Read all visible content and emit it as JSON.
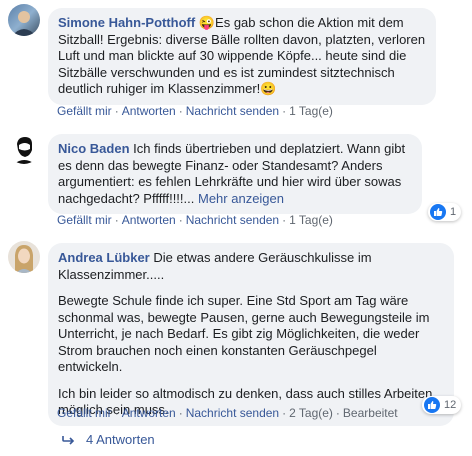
{
  "comments": [
    {
      "author": "Simone Hahn-Potthoff",
      "emoji_after_author": "😜",
      "text": "Es gab schon die Aktion mit dem Sitzball! Ergebnis: diverse Bälle rollten davon, platzten, verloren Luft und man blickte auf 30 wippende Köpfe... heute sind die Sitzbälle verschwunden und es ist zumindest sitztechnisch deutlich ruhiger im Klassenzimmer!",
      "emoji_end": "😀",
      "actions": {
        "like": "Gefällt mir",
        "reply": "Antworten",
        "message": "Nachricht senden",
        "time": "1 Tag(e)"
      }
    },
    {
      "author": "Nico Baden",
      "text": "Ich finds übertrieben und deplatziert. Wann gibt es denn das bewegte Finanz- oder Standesamt? Anders argumentiert: es fehlen Lehrkräfte und hier wird über sowas nachgedacht? Pfffff!!!!...",
      "more": "Mehr anzeigen",
      "actions": {
        "like": "Gefällt mir",
        "reply": "Antworten",
        "message": "Nachricht senden",
        "time": "1 Tag(e)"
      },
      "reaction_count": "1"
    },
    {
      "author": "Andrea Lübker",
      "text_p1": "Die etwas andere Geräuschkulisse im Klassenzimmer.....",
      "text_p2": "Bewegte Schule finde ich super. Eine Std Sport am Tag wäre schonmal was, bewegte Pausen, gerne auch Bewegungsteile im Unterricht, je nach Bedarf. Es gibt zig Möglichkeiten, die weder Strom brauchen noch einen konstanten Geräuschpegel entwickeln.",
      "text_p3": "Ich bin leider so altmodisch zu denken, dass auch stilles Arbeiten möglich sein muss.",
      "actions": {
        "like": "Gefällt mir",
        "reply": "Antworten",
        "message": "Nachricht senden",
        "time": "2 Tag(e)",
        "edited": "Bearbeitet"
      },
      "reaction_count": "12"
    }
  ],
  "replies_link": "4 Antworten",
  "colors": {
    "link": "#385898",
    "bubble": "#f0f2f5",
    "like_blue": "#1877f2"
  }
}
